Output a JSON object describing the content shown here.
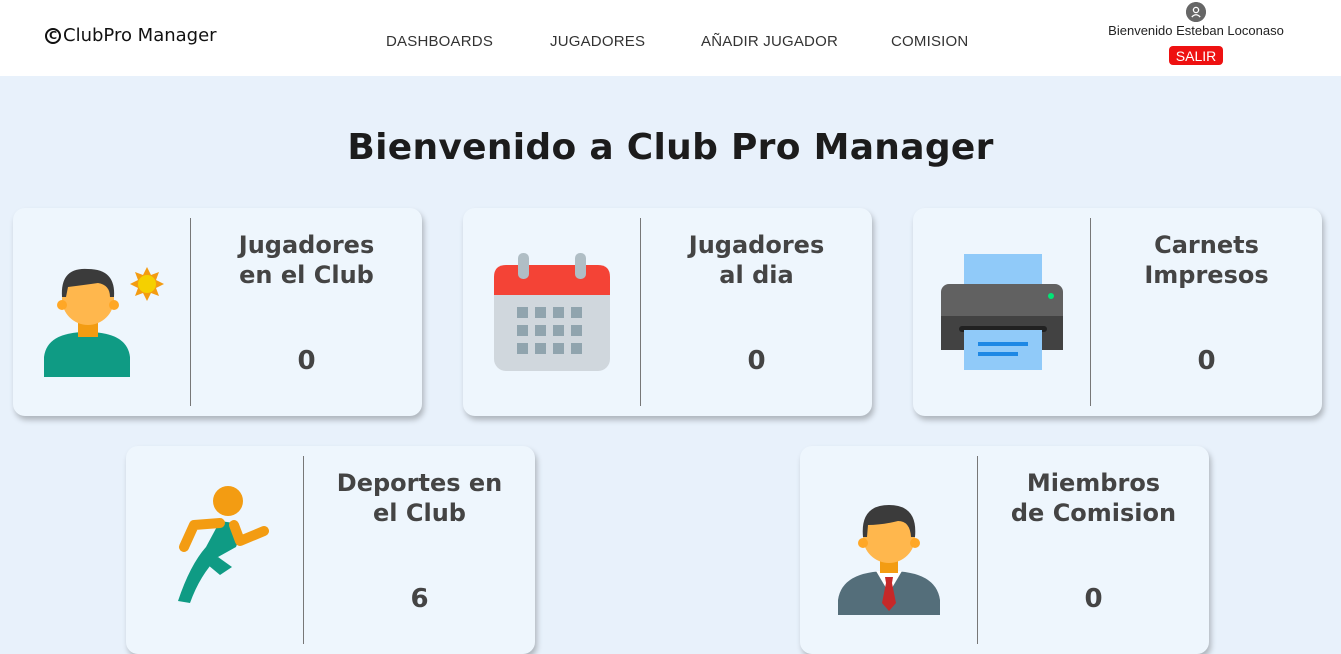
{
  "nav": {
    "brand": "ClubPro Manager",
    "brand_mark": "C",
    "links": [
      "DASHBOARDS",
      "JUGADORES",
      "AÑADIR JUGADOR",
      "COMISION"
    ],
    "welcome": "Bienvenido Esteban Loconaso",
    "logout": "SALIR",
    "user_icon": "user-icon"
  },
  "title": "Bienvenido a Club Pro Manager",
  "cards": [
    {
      "title_line1": "Jugadores",
      "title_line2": "en el Club",
      "value": "0",
      "icon": "player-sun-icon"
    },
    {
      "title_line1": "Jugadores",
      "title_line2": "al dia",
      "value": "0",
      "icon": "calendar-icon"
    },
    {
      "title_line1": "Carnets",
      "title_line2": "Impresos",
      "value": "0",
      "icon": "printer-icon"
    },
    {
      "title_line1": "Deportes en",
      "title_line2": "el Club",
      "value": "6",
      "icon": "runner-icon"
    },
    {
      "title_line1": "Miembros",
      "title_line2": "de Comision",
      "value": "0",
      "icon": "businessman-icon"
    }
  ],
  "colors": {
    "background": "#e8f1fb",
    "card": "#eef6fd",
    "logout": "#ee1111"
  }
}
